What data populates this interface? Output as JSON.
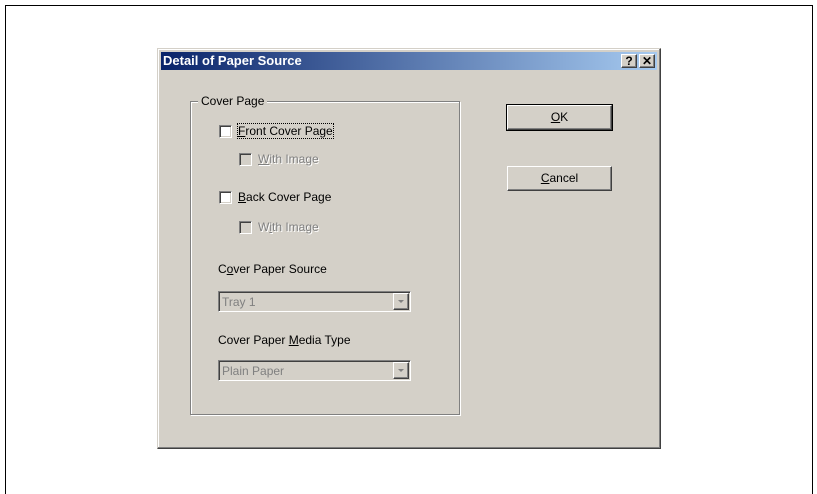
{
  "dialog": {
    "title": "Detail of Paper Source",
    "help_glyph": "?",
    "close_glyph": "✕"
  },
  "cover_page": {
    "group_label": "Cover Page",
    "front_cover": {
      "label": "Front Cover Page",
      "mnemonic": "F",
      "checked": false
    },
    "front_with_image": {
      "label": "With Image",
      "mnemonic": "W",
      "checked": false,
      "enabled": false
    },
    "back_cover": {
      "label": "Back Cover Page",
      "mnemonic": "B",
      "checked": false
    },
    "back_with_image": {
      "label": "With Image",
      "mnemonic": "i",
      "checked": false,
      "enabled": false
    },
    "source": {
      "label": "Cover Paper Source",
      "mnemonic": "o",
      "value": "Tray 1",
      "enabled": false
    },
    "media_type": {
      "label": "Cover Paper Media Type",
      "mnemonic": "M",
      "value": "Plain Paper",
      "enabled": false
    }
  },
  "buttons": {
    "ok": "OK",
    "cancel": "Cancel"
  },
  "colors": {
    "dialog_face": "#d4d0c8",
    "titlebar_start": "#0a246a",
    "titlebar_end": "#a6caf0",
    "disabled_text": "#808080"
  }
}
